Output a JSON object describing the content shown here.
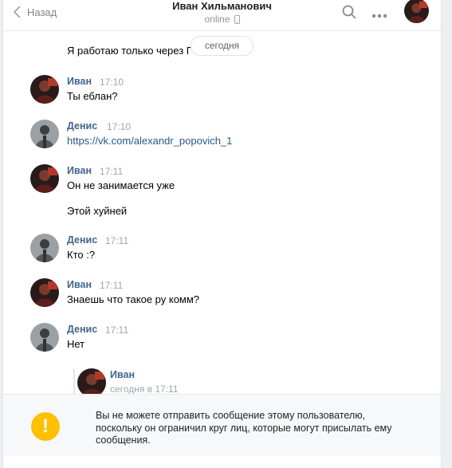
{
  "header": {
    "back_label": "Назад",
    "title": "Иван Хильманович",
    "status": "online"
  },
  "chat": {
    "date_divider": "сегодня",
    "orphan_text": "Я работаю только через Г",
    "messages": [
      {
        "author": "Иван",
        "time": "17:10",
        "lines": [
          "Ты еблан?"
        ],
        "avatar": "ivan"
      },
      {
        "author": "Денис",
        "time": "17:10",
        "lines": [
          "https://vk.com/alexandr_popovich_1"
        ],
        "avatar": "denis"
      },
      {
        "author": "Иван",
        "time": "17:11",
        "lines": [
          "Он не занимается уже",
          "Этой хуйней"
        ],
        "avatar": "ivan"
      },
      {
        "author": "Денис",
        "time": "17:11",
        "lines": [
          "Кто :?"
        ],
        "avatar": "denis"
      },
      {
        "author": "Иван",
        "time": "17:11",
        "lines": [
          "Знаешь что такое ру комм?"
        ],
        "avatar": "ivan"
      },
      {
        "author": "Денис",
        "time": "17:11",
        "lines": [
          "Нет"
        ],
        "avatar": "denis"
      }
    ],
    "forwarded": {
      "author": "Иван",
      "time": "сегодня в 17:11"
    }
  },
  "footer": {
    "notice": "Вы не можете отправить сообщение этому пользователю, поскольку он ограничил круг лиц, которые могут присылать ему сообщения."
  },
  "icons": [
    "chevron-left-icon",
    "phone-icon",
    "search-icon",
    "more-icon",
    "warning-icon"
  ],
  "colors": {
    "link": "#2a5885",
    "name": "#42648b",
    "warning": "#ffc002",
    "background": "#edeef0"
  }
}
